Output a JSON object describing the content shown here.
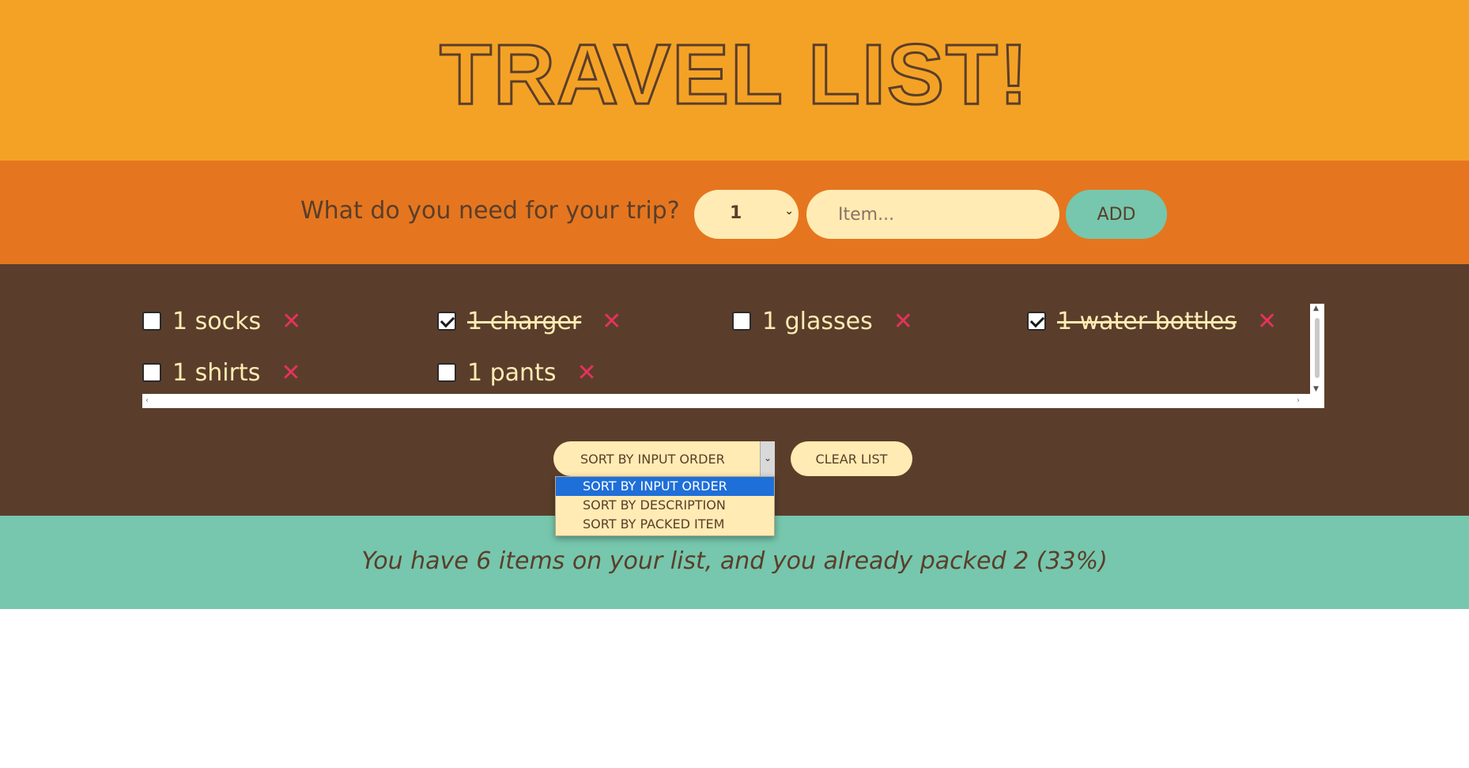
{
  "header": {
    "logo_text": "TRAVEL LIST!"
  },
  "add_form": {
    "question": "What do you need for your trip?",
    "quantity_value": "1",
    "item_placeholder": "Item...",
    "add_label": "ADD"
  },
  "items": [
    {
      "text": "1 socks",
      "packed": false
    },
    {
      "text": "1 charger",
      "packed": true
    },
    {
      "text": "1 glasses",
      "packed": false
    },
    {
      "text": "1 water bottles",
      "packed": true
    },
    {
      "text": "1 shirts",
      "packed": false
    },
    {
      "text": "1 pants",
      "packed": false
    }
  ],
  "delete_glyph": "✕",
  "actions": {
    "sort_value": "SORT BY INPUT ORDER",
    "sort_options": [
      "SORT BY INPUT ORDER",
      "SORT BY DESCRIPTION",
      "SORT BY PACKED ITEM"
    ],
    "clear_label": "CLEAR LIST"
  },
  "stats": {
    "text": "You have 6 items on your list, and you already packed 2 (33%)"
  },
  "colors": {
    "header_bg": "#f4a226",
    "form_bg": "#e5761f",
    "list_bg": "#5a3e2b",
    "stats_bg": "#76c7ad",
    "cream": "#ffebb3",
    "delete_red": "#e5325c"
  }
}
